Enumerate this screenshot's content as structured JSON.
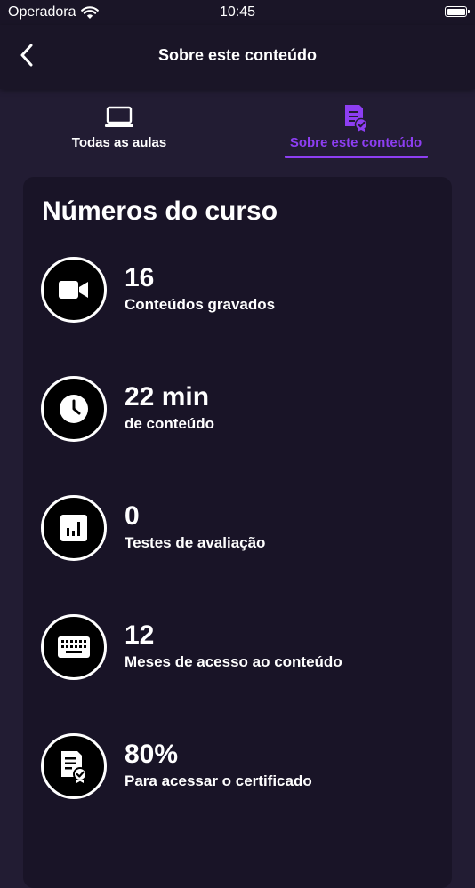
{
  "status_bar": {
    "carrier": "Operadora",
    "time": "10:45",
    "wifi_icon": "wifi-icon",
    "battery_icon": "battery-icon"
  },
  "nav": {
    "back_icon": "chevron-left-icon",
    "title": "Sobre este conteúdo"
  },
  "tabs": [
    {
      "label": "Todas as aulas",
      "icon": "laptop-icon",
      "active": false
    },
    {
      "label": "Sobre este conteúdo",
      "icon": "certificate-doc-icon",
      "active": true
    }
  ],
  "course_numbers": {
    "title": "Números do curso",
    "items": [
      {
        "value": "16",
        "label": "Conteúdos gravados",
        "icon": "video-camera-icon"
      },
      {
        "value": "22 min",
        "label": "de conteúdo",
        "icon": "clock-icon"
      },
      {
        "value": "0",
        "label": "Testes de avaliação",
        "icon": "bar-chart-icon"
      },
      {
        "value": "12",
        "label": "Meses de acesso ao conteúdo",
        "icon": "keyboard-icon"
      },
      {
        "value": "80%",
        "label": "Para acessar o certificado",
        "icon": "certificate-icon"
      }
    ]
  },
  "colors": {
    "background": "#221c33",
    "bar_background": "#1a1527",
    "card_background": "#191427",
    "accent": "#8d3ef2",
    "text": "#ffffff"
  }
}
